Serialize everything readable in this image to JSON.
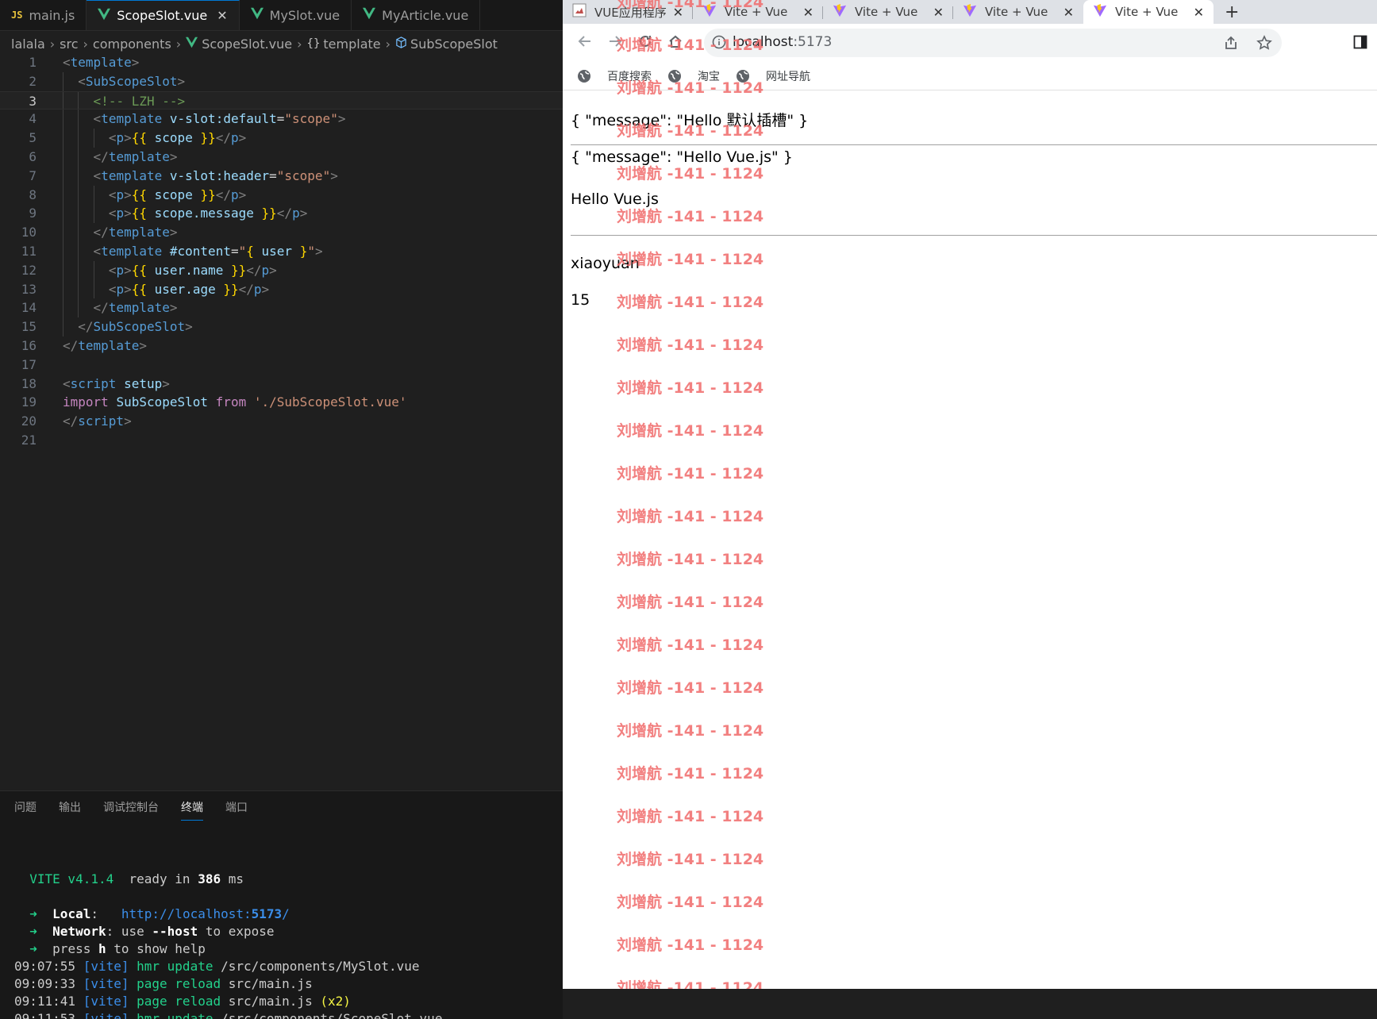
{
  "editor": {
    "tabs": [
      {
        "label": "main.js",
        "type": "js",
        "active": false
      },
      {
        "label": "ScopeSlot.vue",
        "type": "vue",
        "active": true
      },
      {
        "label": "MySlot.vue",
        "type": "vue",
        "active": false
      },
      {
        "label": "MyArticle.vue",
        "type": "vue",
        "active": false
      }
    ],
    "js_badge": "JS",
    "breadcrumb": [
      "lalala",
      "src",
      "components",
      "ScopeSlot.vue",
      "template",
      "SubScopeSlot"
    ],
    "breadcrumb_curly": "{}",
    "current_line": 3,
    "code_lines": [
      {
        "n": "1",
        "indent": 0,
        "tokens": [
          [
            "punc",
            "<"
          ],
          [
            "tag",
            "template"
          ],
          [
            "punc",
            ">"
          ]
        ]
      },
      {
        "n": "2",
        "indent": 1,
        "tokens": [
          [
            "punc",
            "<"
          ],
          [
            "tag",
            "SubScopeSlot"
          ],
          [
            "punc",
            ">"
          ]
        ]
      },
      {
        "n": "3",
        "indent": 2,
        "tokens": [
          [
            "cmt",
            "<!-- LZH -->"
          ]
        ]
      },
      {
        "n": "4",
        "indent": 2,
        "tokens": [
          [
            "punc",
            "<"
          ],
          [
            "tag",
            "template"
          ],
          [
            "plain",
            " "
          ],
          [
            "attr",
            "v-slot:default"
          ],
          [
            "plain",
            "="
          ],
          [
            "str",
            "\"scope\""
          ],
          [
            "punc",
            ">"
          ]
        ]
      },
      {
        "n": "5",
        "indent": 3,
        "tokens": [
          [
            "punc",
            "<"
          ],
          [
            "tag",
            "p"
          ],
          [
            "punc",
            ">"
          ],
          [
            "brace",
            "{{"
          ],
          [
            "plain",
            " "
          ],
          [
            "var",
            "scope"
          ],
          [
            "plain",
            " "
          ],
          [
            "brace",
            "}}"
          ],
          [
            "punc",
            "</"
          ],
          [
            "tag",
            "p"
          ],
          [
            "punc",
            ">"
          ]
        ]
      },
      {
        "n": "6",
        "indent": 2,
        "tokens": [
          [
            "punc",
            "</"
          ],
          [
            "tag",
            "template"
          ],
          [
            "punc",
            ">"
          ]
        ]
      },
      {
        "n": "7",
        "indent": 2,
        "tokens": [
          [
            "punc",
            "<"
          ],
          [
            "tag",
            "template"
          ],
          [
            "plain",
            " "
          ],
          [
            "attr",
            "v-slot:header"
          ],
          [
            "plain",
            "="
          ],
          [
            "str",
            "\"scope\""
          ],
          [
            "punc",
            ">"
          ]
        ]
      },
      {
        "n": "8",
        "indent": 3,
        "tokens": [
          [
            "punc",
            "<"
          ],
          [
            "tag",
            "p"
          ],
          [
            "punc",
            ">"
          ],
          [
            "brace",
            "{{"
          ],
          [
            "plain",
            " "
          ],
          [
            "var",
            "scope"
          ],
          [
            "plain",
            " "
          ],
          [
            "brace",
            "}}"
          ],
          [
            "punc",
            "</"
          ],
          [
            "tag",
            "p"
          ],
          [
            "punc",
            ">"
          ]
        ]
      },
      {
        "n": "9",
        "indent": 3,
        "tokens": [
          [
            "punc",
            "<"
          ],
          [
            "tag",
            "p"
          ],
          [
            "punc",
            ">"
          ],
          [
            "brace",
            "{{"
          ],
          [
            "plain",
            " "
          ],
          [
            "var",
            "scope.message"
          ],
          [
            "plain",
            " "
          ],
          [
            "brace",
            "}}"
          ],
          [
            "punc",
            "</"
          ],
          [
            "tag",
            "p"
          ],
          [
            "punc",
            ">"
          ]
        ]
      },
      {
        "n": "10",
        "indent": 2,
        "tokens": [
          [
            "punc",
            "</"
          ],
          [
            "tag",
            "template"
          ],
          [
            "punc",
            ">"
          ]
        ]
      },
      {
        "n": "11",
        "indent": 2,
        "tokens": [
          [
            "punc",
            "<"
          ],
          [
            "tag",
            "template"
          ],
          [
            "plain",
            " "
          ],
          [
            "attr",
            "#content"
          ],
          [
            "plain",
            "="
          ],
          [
            "str",
            "\""
          ],
          [
            "brace",
            "{"
          ],
          [
            "plain",
            " "
          ],
          [
            "var",
            "user"
          ],
          [
            "plain",
            " "
          ],
          [
            "brace",
            "}"
          ],
          [
            "str",
            "\""
          ],
          [
            "punc",
            ">"
          ]
        ]
      },
      {
        "n": "12",
        "indent": 3,
        "tokens": [
          [
            "punc",
            "<"
          ],
          [
            "tag",
            "p"
          ],
          [
            "punc",
            ">"
          ],
          [
            "brace",
            "{{"
          ],
          [
            "plain",
            " "
          ],
          [
            "var",
            "user.name"
          ],
          [
            "plain",
            " "
          ],
          [
            "brace",
            "}}"
          ],
          [
            "punc",
            "</"
          ],
          [
            "tag",
            "p"
          ],
          [
            "punc",
            ">"
          ]
        ]
      },
      {
        "n": "13",
        "indent": 3,
        "tokens": [
          [
            "punc",
            "<"
          ],
          [
            "tag",
            "p"
          ],
          [
            "punc",
            ">"
          ],
          [
            "brace",
            "{{"
          ],
          [
            "plain",
            " "
          ],
          [
            "var",
            "user.age"
          ],
          [
            "plain",
            " "
          ],
          [
            "brace",
            "}}"
          ],
          [
            "punc",
            "</"
          ],
          [
            "tag",
            "p"
          ],
          [
            "punc",
            ">"
          ]
        ]
      },
      {
        "n": "14",
        "indent": 2,
        "tokens": [
          [
            "punc",
            "</"
          ],
          [
            "tag",
            "template"
          ],
          [
            "punc",
            ">"
          ]
        ]
      },
      {
        "n": "15",
        "indent": 1,
        "tokens": [
          [
            "punc",
            "</"
          ],
          [
            "tag",
            "SubScopeSlot"
          ],
          [
            "punc",
            ">"
          ]
        ]
      },
      {
        "n": "16",
        "indent": 0,
        "tokens": [
          [
            "punc",
            "</"
          ],
          [
            "tag",
            "template"
          ],
          [
            "punc",
            ">"
          ]
        ]
      },
      {
        "n": "17",
        "indent": 0,
        "tokens": []
      },
      {
        "n": "18",
        "indent": 0,
        "tokens": [
          [
            "punc",
            "<"
          ],
          [
            "tag",
            "script"
          ],
          [
            "plain",
            " "
          ],
          [
            "attr",
            "setup"
          ],
          [
            "punc",
            ">"
          ]
        ]
      },
      {
        "n": "19",
        "indent": 0,
        "tokens": [
          [
            "kw",
            "import"
          ],
          [
            "plain",
            " "
          ],
          [
            "cls",
            "SubScopeSlot"
          ],
          [
            "plain",
            " "
          ],
          [
            "kw",
            "from"
          ],
          [
            "plain",
            " "
          ],
          [
            "str",
            "'./SubScopeSlot.vue'"
          ]
        ]
      },
      {
        "n": "20",
        "indent": 0,
        "tokens": [
          [
            "punc",
            "</"
          ],
          [
            "tag",
            "script"
          ],
          [
            "punc",
            ">"
          ]
        ]
      },
      {
        "n": "21",
        "indent": 0,
        "tokens": []
      }
    ]
  },
  "panel": {
    "tabs": [
      "问题",
      "输出",
      "调试控制台",
      "终端",
      "端口"
    ],
    "active_tab": "终端",
    "terminal_lines": [
      [],
      [
        [
          "g",
          "  VITE v4.1.4"
        ],
        [
          "p",
          "  ready in "
        ],
        [
          "b",
          "386"
        ],
        [
          "p",
          " ms"
        ]
      ],
      [],
      [
        [
          "g",
          "  ➜  "
        ],
        [
          "b",
          "Local"
        ],
        [
          "p",
          ":   "
        ],
        [
          "u",
          "http://localhost:"
        ],
        [
          "ub",
          "5173"
        ],
        [
          "u",
          "/"
        ]
      ],
      [
        [
          "g",
          "  ➜  "
        ],
        [
          "b",
          "Network"
        ],
        [
          "p",
          ": use "
        ],
        [
          "b",
          "--host"
        ],
        [
          "p",
          " to expose"
        ]
      ],
      [
        [
          "g",
          "  ➜  "
        ],
        [
          "p",
          "press "
        ],
        [
          "b",
          "h"
        ],
        [
          "p",
          " to show help"
        ]
      ],
      [
        [
          "p",
          "09:07:55 "
        ],
        [
          "u",
          "[vite]"
        ],
        [
          "g",
          " hmr update "
        ],
        [
          "p",
          "/src/components/MySlot.vue"
        ]
      ],
      [
        [
          "p",
          "09:09:33 "
        ],
        [
          "u",
          "[vite]"
        ],
        [
          "g",
          " page reload "
        ],
        [
          "p",
          "src/main.js"
        ]
      ],
      [
        [
          "p",
          "09:11:41 "
        ],
        [
          "u",
          "[vite]"
        ],
        [
          "g",
          " page reload "
        ],
        [
          "p",
          "src/main.js "
        ],
        [
          "y",
          "(x2)"
        ]
      ],
      [
        [
          "p",
          "09:11:53 "
        ],
        [
          "u",
          "[vite]"
        ],
        [
          "g",
          " hmr update "
        ],
        [
          "p",
          "/src/components/ScopeSlot.vue"
        ]
      ]
    ]
  },
  "browser": {
    "tabs": [
      {
        "title": "VUE应用程序",
        "icon": "page",
        "active": false
      },
      {
        "title": "Vite + Vue",
        "icon": "vite",
        "active": false
      },
      {
        "title": "Vite + Vue",
        "icon": "vite",
        "active": false
      },
      {
        "title": "Vite + Vue",
        "icon": "vite",
        "active": false
      },
      {
        "title": "Vite + Vue",
        "icon": "vite",
        "active": true
      }
    ],
    "new_tab": "+",
    "url_host": "localhost",
    "url_port": ":5173",
    "bookmarks": [
      "百度搜索",
      "淘宝",
      "网址导航"
    ],
    "content": {
      "line1": "{ \"message\": \"Hello 默认插槽\" }",
      "line2": "{ \"message\": \"Hello Vue.js\" }",
      "line3": "Hello Vue.js",
      "line4": "xiaoyuan",
      "line5": "15"
    },
    "watermark_text": "刘增航 -141 - 1124",
    "watermark_count": 24
  },
  "colors": {
    "editor_bg": "#1f1f1f",
    "vue_green": "#41b883",
    "watermark": "#f06b6b"
  }
}
